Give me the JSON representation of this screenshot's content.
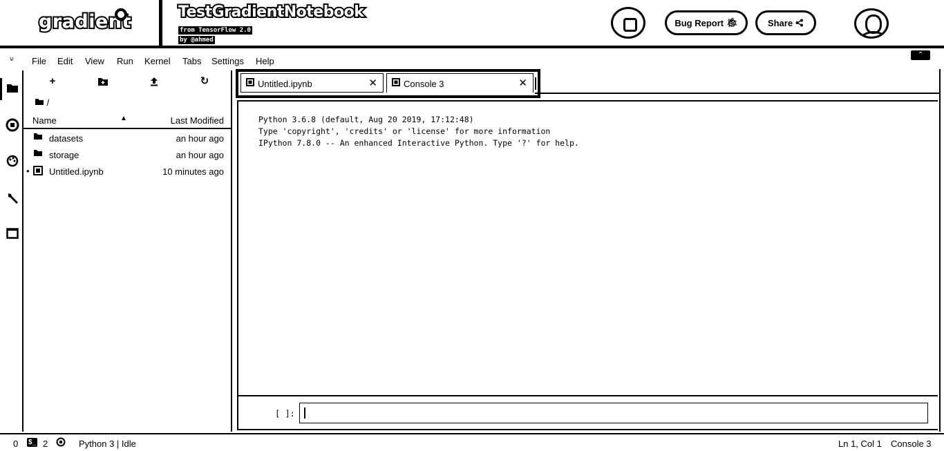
{
  "header": {
    "logo_text": "gradient",
    "notebook_title": "TestGradientNotebook",
    "subtitle_from": "from TensorFlow 2.0",
    "subtitle_by": "by @ahmed",
    "bug_report_label": "Bug Report",
    "share_label": "Share"
  },
  "menu": {
    "items": [
      "File",
      "Edit",
      "View",
      "Run",
      "Kernel",
      "Tabs",
      "Settings",
      "Help"
    ]
  },
  "sidebar": {
    "icons": [
      "folder-icon",
      "running-icon",
      "palette-icon",
      "wrench-icon",
      "tabs-icon"
    ]
  },
  "filebrowser": {
    "breadcrumb": "/",
    "col_name": "Name",
    "col_modified": "Last Modified",
    "files": [
      {
        "name": "datasets",
        "modified": "an hour ago",
        "type": "folder"
      },
      {
        "name": "storage",
        "modified": "an hour ago",
        "type": "folder"
      },
      {
        "name": "Untitled.ipynb",
        "modified": "10 minutes ago",
        "type": "notebook"
      }
    ]
  },
  "tabs": [
    {
      "label": "Untitled.ipynb",
      "icon": "notebook-icon"
    },
    {
      "label": "Console 3",
      "icon": "console-icon"
    }
  ],
  "console": {
    "banner_lines": [
      "Python 3.6.8 (default, Aug 20 2019, 17:12:48)",
      "Type 'copyright', 'credits' or 'license' for more information",
      "IPython 7.8.0 -- An enhanced Interactive Python. Type '?' for help."
    ],
    "prompt": "[ ]:"
  },
  "status": {
    "terminals": "0",
    "kernels": "2",
    "kernel_status": "Python 3 | Idle",
    "cursor": "Ln 1, Col 1",
    "active": "Console 3"
  }
}
